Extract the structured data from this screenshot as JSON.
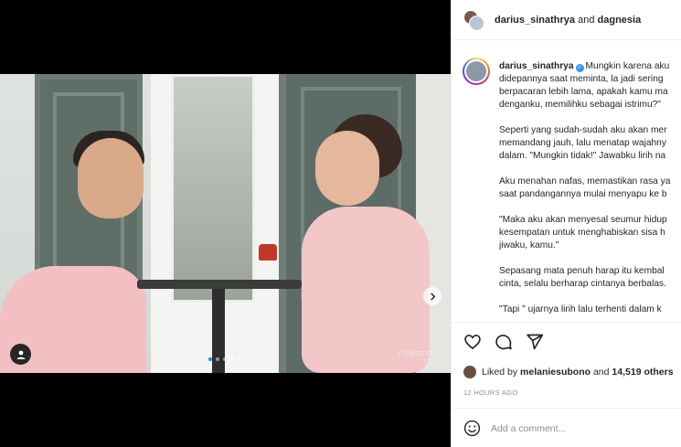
{
  "post": {
    "media": {
      "watermark_line1": "FIXMOTRET",
      "watermark_line2": "2021",
      "carousel_dots": 5,
      "active_dot": 0
    },
    "header": {
      "user1": "darius_sinathrya",
      "and": "and",
      "user2": "dagnesia"
    },
    "caption": {
      "username": "darius_sinathrya",
      "lines": [
        "Mungkin karena aku",
        "didepannya saat meminta, la jadi sering",
        "berpacaran lebih lama, apakah kamu ma",
        "denganku, memilihku sebagai istrimu?\"",
        "",
        "Seperti yang sudah-sudah aku akan mer",
        "memandang jauh, lalu menatap wajahny",
        "dalam. \"Mungkin tidak!\" Jawabku lirih na",
        "",
        "Aku menahan nafas, memastikan rasa ya",
        "saat pandangannya mulai menyapu ke b",
        "",
        "\"Maka aku akan menyesal seumur hidup",
        "kesempatan untuk menghabiskan sisa h",
        "jiwaku, kamu.\"",
        "",
        "Sepasang mata penuh harap itu kembal",
        "cinta, selalu berharap cintanya berbalas.",
        "",
        "\"Tapi \" ujarnya lirih lalu terhenti dalam k"
      ]
    },
    "likes": {
      "prefix": "Liked by",
      "user": "melaniesubono",
      "and": "and",
      "count": "14,519 others"
    },
    "timestamp": "12 HOURS AGO",
    "comment_input": {
      "placeholder": "Add a comment..."
    }
  },
  "icons": {
    "like": "heart-icon",
    "comment": "comment-icon",
    "share": "paper-plane-icon",
    "emoji": "smiley-icon",
    "next": "chevron-right-icon",
    "tag": "user-tag-icon"
  },
  "colors": {
    "verified": "#3897f0",
    "active_dot": "#0095f6",
    "muted_text": "#8e8e8e"
  }
}
